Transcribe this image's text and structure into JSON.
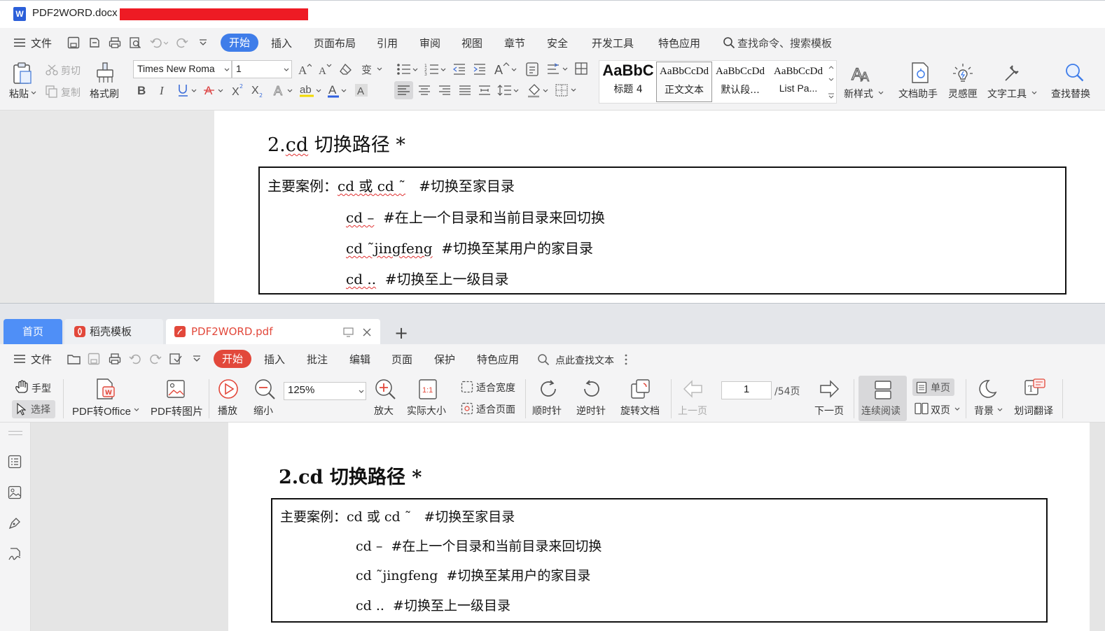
{
  "word": {
    "title": "PDF2WORD.docx",
    "menu": {
      "file": "文件",
      "tabs": [
        "开始",
        "插入",
        "页面布局",
        "引用",
        "审阅",
        "视图",
        "章节",
        "安全",
        "开发工具",
        "特色应用"
      ],
      "search": "查找命令、搜索模板"
    },
    "ribbon": {
      "paste": "粘贴",
      "cut": "剪切",
      "copy": "复制",
      "format_painter": "格式刷",
      "font_name": "Times New Roma",
      "font_size": "1",
      "styles": [
        {
          "preview": "AaBbC",
          "label": "标题 4"
        },
        {
          "preview": "AaBbCcDd",
          "label": "正文文本"
        },
        {
          "preview": "AaBbCcDd",
          "label": "默认段..."
        },
        {
          "preview": "AaBbCcDd",
          "label": "List Pa..."
        }
      ],
      "new_style": "新样式",
      "doc_assistant": "文档助手",
      "inspiration": "灵感匣",
      "text_tools": "文字工具",
      "find_replace": "查找替换"
    }
  },
  "document": {
    "heading": "2.cd 切换路径 *",
    "heading_num": "2.",
    "heading_cd": "cd",
    "heading_rest": " 切换路径 *",
    "line1_label": "主要案例：",
    "line1_cmd": "cd 或 cd ˜",
    "line1_comment": "#切换至家目录",
    "line2_cmd": "cd –",
    "line2_comment": "#在上一个目录和当前目录来回切换",
    "line3_cmd": "cd ˜jingfeng",
    "line3_comment": "#切换至某用户的家目录",
    "line4_cmd": "cd ..",
    "line4_comment": "#切换至上一级目录"
  },
  "pdf": {
    "tabs": {
      "home": "首页",
      "template": "稻壳模板",
      "file": "PDF2WORD.pdf",
      "add": "+"
    },
    "menu": {
      "file": "文件",
      "tabs": [
        "开始",
        "插入",
        "批注",
        "编辑",
        "页面",
        "保护",
        "特色应用"
      ],
      "search": "点此查找文本"
    },
    "ribbon": {
      "hand": "手型",
      "select": "选择",
      "pdf_to_office": "PDF转Office",
      "pdf_to_image": "PDF转图片",
      "play": "播放",
      "zoom_out": "缩小",
      "zoom": "125%",
      "zoom_in": "放大",
      "actual_size": "实际大小",
      "fit_width": "适合宽度",
      "fit_page": "适合页面",
      "clockwise": "顺时针",
      "counter_clockwise": "逆时针",
      "rotate_doc": "旋转文档",
      "prev_page": "上一页",
      "page_number": "1",
      "page_total": "/54页",
      "next_page": "下一页",
      "continuous": "连续阅读",
      "single": "单页",
      "double": "双页",
      "background": "背景",
      "translate": "划词翻译"
    }
  },
  "colors": {
    "word_accent": "#3f7de9",
    "pdf_accent": "#e2483b",
    "tab_home": "#4f8ff7"
  }
}
